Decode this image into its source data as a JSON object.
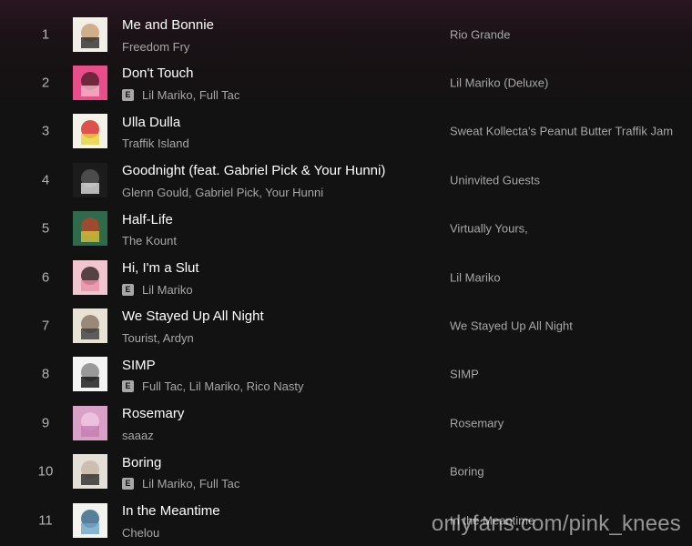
{
  "tracks": [
    {
      "number": "1",
      "title": "Me and Bonnie",
      "artists": "Freedom Fry",
      "explicit": false,
      "album": "Rio Grande",
      "cover_colors": [
        "#f2efe9",
        "#2a2a2a",
        "#c9a27a"
      ]
    },
    {
      "number": "2",
      "title": "Don't Touch",
      "artists": "Lil Mariko, Full Tac",
      "explicit": true,
      "album": "Lil Mariko (Deluxe)",
      "cover_colors": [
        "#e84f8a",
        "#f6b7c8",
        "#5a2030"
      ]
    },
    {
      "number": "3",
      "title": "Ulla Dulla",
      "artists": "Traffik Island",
      "explicit": false,
      "album": "Sweat Kollecta's Peanut Butter Traffik Jam",
      "cover_colors": [
        "#f5f2ea",
        "#e8d23a",
        "#d8362e"
      ]
    },
    {
      "number": "4",
      "title": "Goodnight (feat. Gabriel Pick & Your Hunni)",
      "artists": "Glenn Gould, Gabriel Pick, Your Hunni",
      "explicit": false,
      "album": "Uninvited Guests",
      "cover_colors": [
        "#1c1c1c",
        "#e0e0e0",
        "#555555"
      ]
    },
    {
      "number": "5",
      "title": "Half-Life",
      "artists": "The Kount",
      "explicit": false,
      "album": "Virtually Yours,",
      "cover_colors": [
        "#2f6b4a",
        "#d9c13a",
        "#b0442c"
      ]
    },
    {
      "number": "6",
      "title": "Hi, I'm a Slut",
      "artists": "Lil Mariko",
      "explicit": true,
      "album": "Lil Mariko",
      "cover_colors": [
        "#f2c6d0",
        "#e890a8",
        "#3a2a2a"
      ]
    },
    {
      "number": "7",
      "title": "We Stayed Up All Night",
      "artists": "Tourist, Ardyn",
      "explicit": false,
      "album": "We Stayed Up All Night",
      "cover_colors": [
        "#e9e3d6",
        "#3a3a3a",
        "#8a7a66"
      ]
    },
    {
      "number": "8",
      "title": "SIMP",
      "artists": "Full Tac, Lil Mariko, Rico Nasty",
      "explicit": true,
      "album": "SIMP",
      "cover_colors": [
        "#f4f4f4",
        "#111111",
        "#888888"
      ]
    },
    {
      "number": "9",
      "title": "Rosemary",
      "artists": "saaaz",
      "explicit": false,
      "album": "Rosemary",
      "cover_colors": [
        "#d9a0c8",
        "#c47db2",
        "#efc6e2"
      ]
    },
    {
      "number": "10",
      "title": "Boring",
      "artists": "Lil Mariko, Full Tac",
      "explicit": true,
      "album": "Boring",
      "cover_colors": [
        "#e4e0d8",
        "#2a2a2a",
        "#c9b8a8"
      ]
    },
    {
      "number": "11",
      "title": "In the Meantime",
      "artists": "Chelou",
      "explicit": false,
      "album": "In the Meantime",
      "cover_colors": [
        "#f3f3f0",
        "#6ea4c8",
        "#3a6a8a"
      ]
    }
  ],
  "explicit_label": "E",
  "watermark": "onlyfans.com/pink_knees"
}
